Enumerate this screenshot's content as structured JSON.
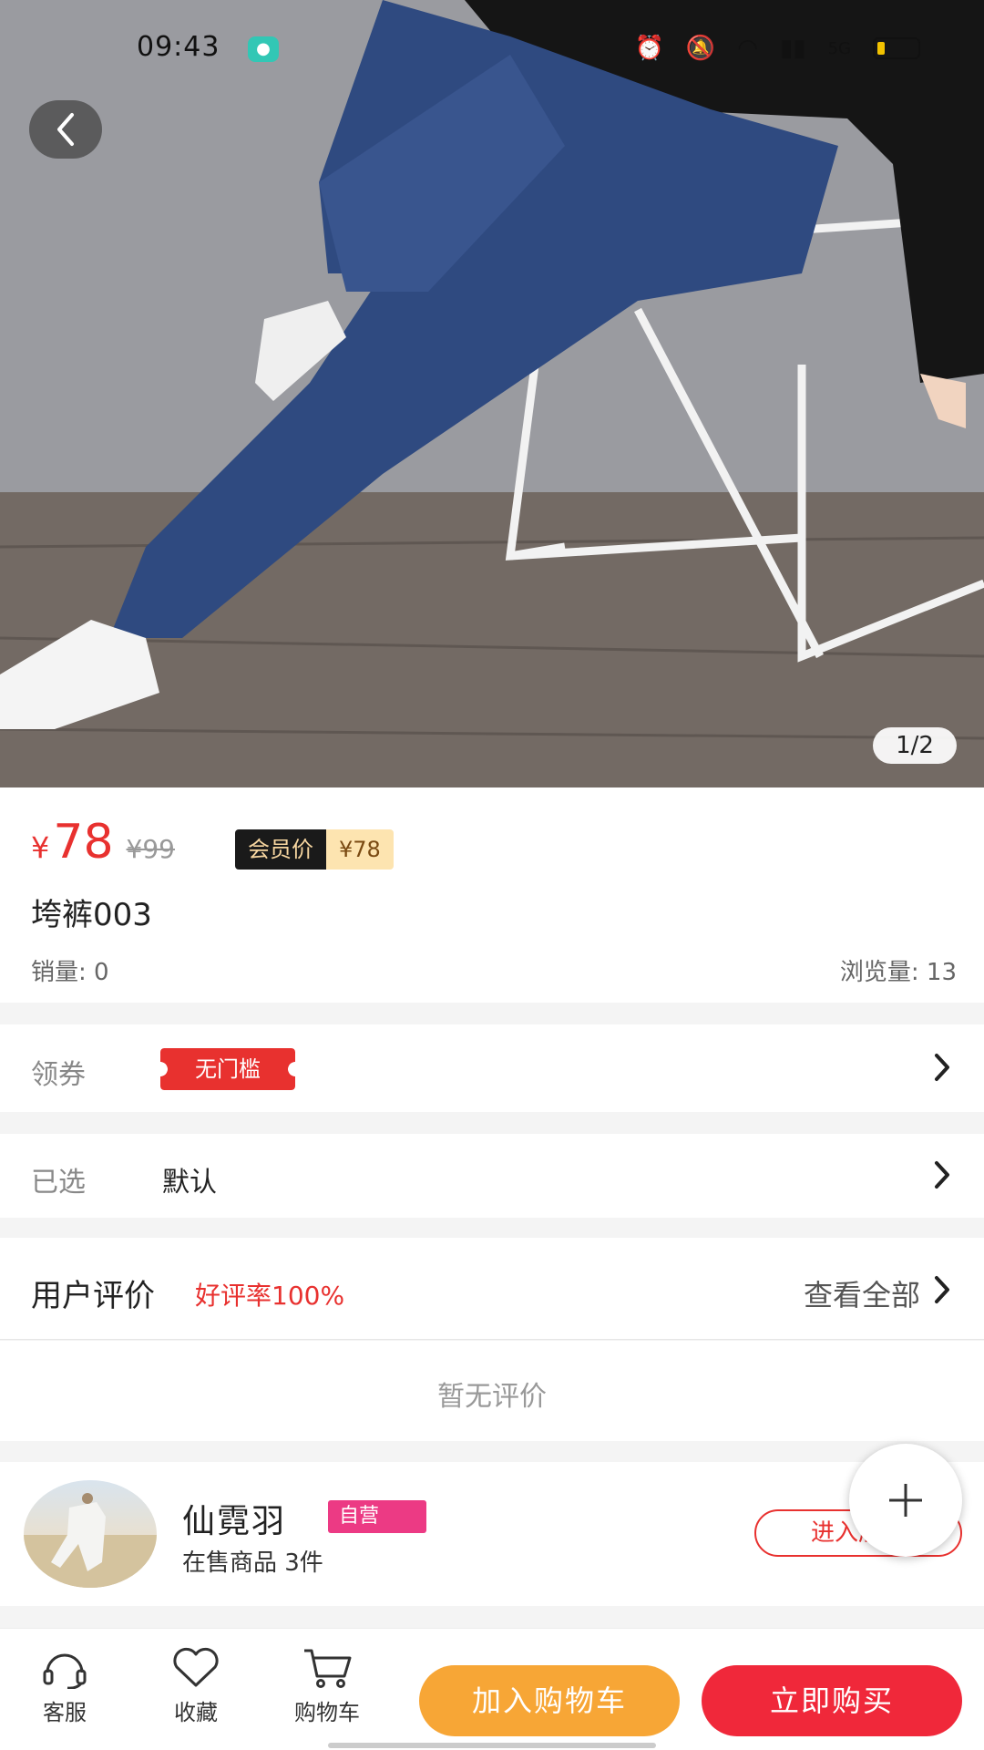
{
  "status": {
    "time": "09:43",
    "chat_icon": "chat-bubble-icon",
    "network": "5G"
  },
  "gallery": {
    "page_indicator": "1/2"
  },
  "product": {
    "price_symbol": "¥",
    "price": "78",
    "original_price": "¥99",
    "member_label": "会员价",
    "member_price": "¥78",
    "title": "垮裤003",
    "sales": "销量: 0",
    "views": "浏览量: 13"
  },
  "coupon": {
    "label": "领券",
    "tag": "无门槛"
  },
  "selected": {
    "label": "已选",
    "value": "默认"
  },
  "reviews": {
    "title": "用户评价",
    "rate": "好评率100%",
    "view_all": "查看全部",
    "empty": "暂无评价"
  },
  "shop": {
    "name": "仙霓羽",
    "tag": "自营",
    "count": "在售商品 3件",
    "enter": "进入店铺"
  },
  "bottom": {
    "service": "客服",
    "favorite": "收藏",
    "cart": "购物车",
    "add_to_cart": "加入购物车",
    "buy_now": "立即购买"
  },
  "colors": {
    "accent_red": "#e8312f",
    "cart_orange": "#f7a636",
    "buy_red": "#f0283a",
    "self_tag_pink": "#ec3a84"
  }
}
